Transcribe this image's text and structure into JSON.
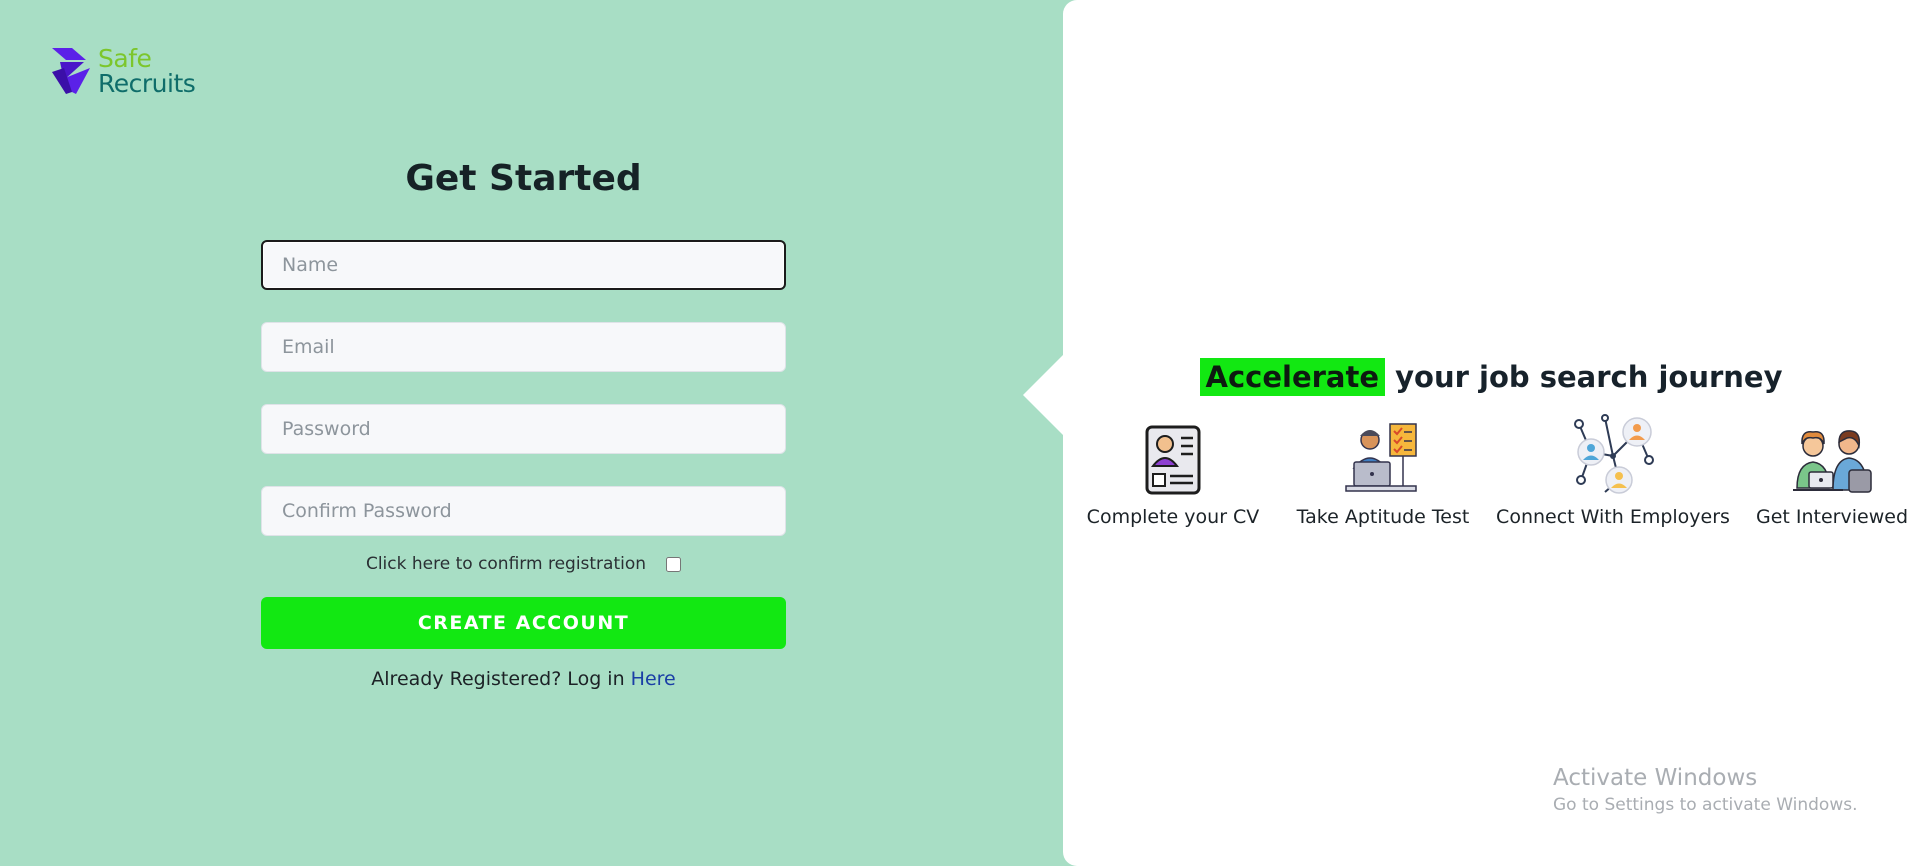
{
  "brand": {
    "line1": "Safe",
    "line2": "Recruits",
    "colors": {
      "mark": "#5b21e8",
      "text_line1": "#7cc62c",
      "text_line2": "#0f6d6a"
    }
  },
  "form": {
    "title": "Get Started",
    "name_placeholder": "Name",
    "email_placeholder": "Email",
    "password_placeholder": "Password",
    "confirm_placeholder": "Confirm Password",
    "confirm_label": "Click here to confirm registration",
    "create_label": "CREATE ACCOUNT",
    "login_prefix": "Already Registered? Log in ",
    "login_link": "Here"
  },
  "promo": {
    "highlight": "Accelerate",
    "rest": " your job search journey",
    "steps": [
      {
        "icon": "cv-document-icon",
        "label": "Complete your CV"
      },
      {
        "icon": "aptitude-test-icon",
        "label": "Take Aptitude Test"
      },
      {
        "icon": "network-people-icon",
        "label": "Connect With Employers"
      },
      {
        "icon": "interview-icon",
        "label": "Get Interviewed"
      }
    ]
  },
  "watermark": {
    "title": "Activate Windows",
    "subtitle": "Go to Settings to activate Windows."
  },
  "colors": {
    "left_background": "#a8dec5",
    "accent_green": "#12e812",
    "link_blue": "#1a3ea6"
  }
}
